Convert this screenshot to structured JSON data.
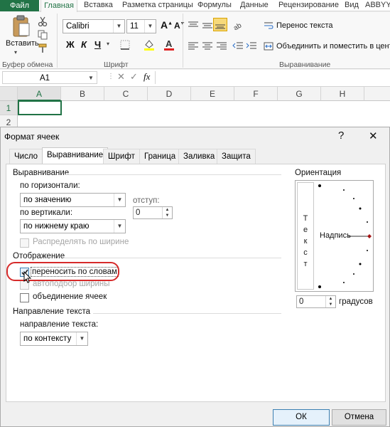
{
  "ribbon": {
    "tabs": {
      "file": "Файл",
      "home": "Главная",
      "insert": "Вставка",
      "page_layout": "Разметка страницы",
      "formulas": "Формулы",
      "data": "Данные",
      "review": "Рецензирование",
      "view": "Вид",
      "abbyy": "ABBYY"
    },
    "clipboard": {
      "paste_label": "Вставить",
      "group_label": "Буфер обмена"
    },
    "font": {
      "name": "Calibri",
      "size": "11",
      "group_label": "Шрифт"
    },
    "alignment": {
      "wrap_text": "Перенос текста",
      "merge_center": "Объединить и поместить в центре",
      "group_label": "Выравнивание"
    }
  },
  "formula_bar": {
    "name_box": "A1",
    "fx": "fx"
  },
  "sheet": {
    "columns": [
      "A",
      "B",
      "C",
      "D",
      "E",
      "F",
      "G",
      "H"
    ],
    "rows": [
      "1",
      "2"
    ]
  },
  "dialog": {
    "title": "Формат ячеек",
    "help": "?",
    "close": "✕",
    "tabs": {
      "number": "Число",
      "alignment": "Выравнивание",
      "font": "Шрифт",
      "border": "Граница",
      "fill": "Заливка",
      "protection": "Защита"
    },
    "text_alignment": {
      "section": "Выравнивание",
      "horizontal_label": "по горизонтали:",
      "horizontal_value": "по значению",
      "indent_label": "отступ:",
      "indent_value": "0",
      "vertical_label": "по вертикали:",
      "vertical_value": "по нижнему краю",
      "justify_distributed": "Распределять по ширине"
    },
    "text_control": {
      "section": "Отображение",
      "wrap_text": "переносить по словам",
      "wrap_text_checked": true,
      "shrink_to_fit": "автоподбор ширины",
      "merge_cells": "объединение ячеек"
    },
    "rtl": {
      "section": "Направление текста",
      "direction_label": "направление текста:",
      "direction_value": "по контексту"
    },
    "orientation": {
      "section": "Ориентация",
      "vertical_text": [
        "Т",
        "е",
        "к",
        "с",
        "т"
      ],
      "inscription": "Надпись",
      "degrees_value": "0",
      "degrees_label": "градусов"
    },
    "ok": "ОК",
    "cancel": "Отмена"
  },
  "colors": {
    "excel_green": "#217346",
    "highlight_red": "#d62a2a",
    "selection_blue": "#e5f1fb"
  }
}
